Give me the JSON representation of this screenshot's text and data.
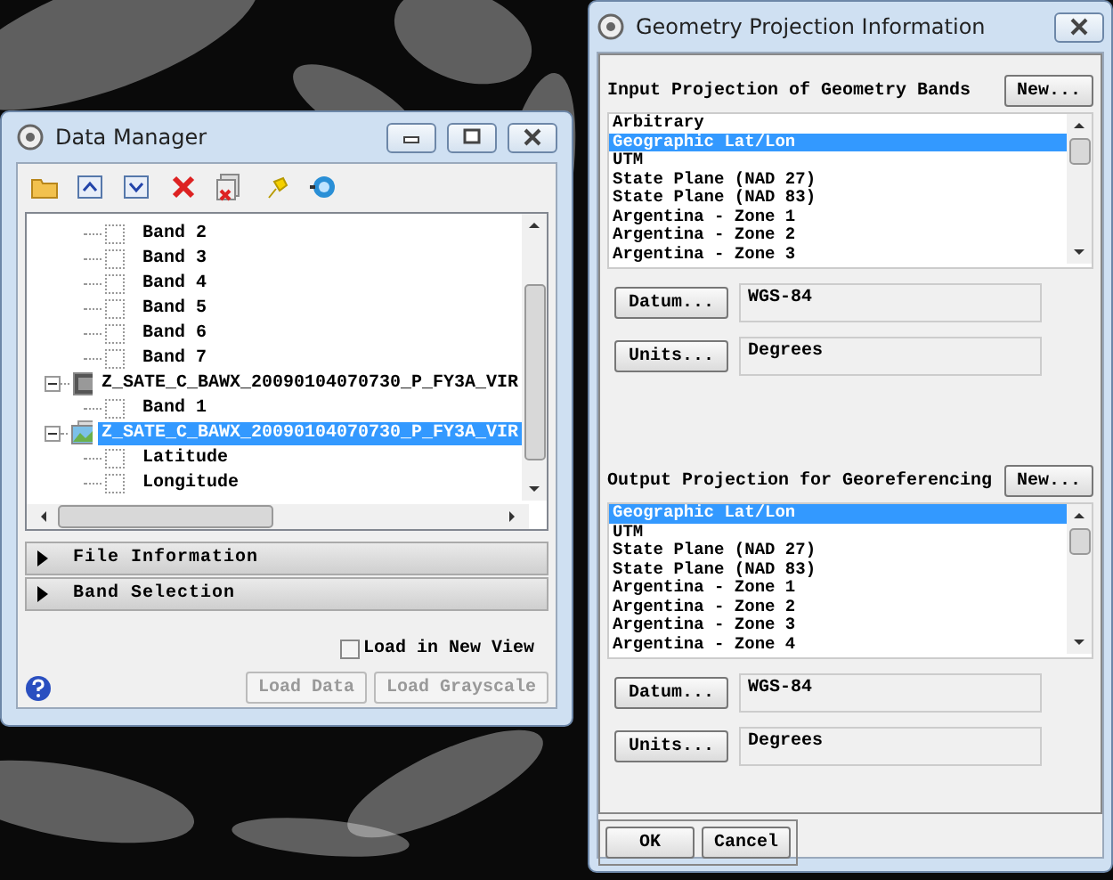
{
  "data_manager": {
    "title": "Data Manager",
    "tree": [
      {
        "children": [
          {
            "label": "Band 2",
            "checked": false
          },
          {
            "label": "Band 3",
            "checked": false
          },
          {
            "label": "Band 4",
            "checked": false
          },
          {
            "label": "Band 5",
            "checked": false
          },
          {
            "label": "Band 6",
            "checked": false
          },
          {
            "label": "Band 7",
            "checked": false
          }
        ]
      },
      {
        "label": "Z_SATE_C_BAWX_20090104070730_P_FY3A_VIR",
        "kind": "raster",
        "expanded": true,
        "selected": false,
        "children": [
          {
            "label": "Band 1",
            "checked": false
          }
        ]
      },
      {
        "label": "Z_SATE_C_BAWX_20090104070730_P_FY3A_VIR",
        "kind": "geo",
        "expanded": true,
        "selected": true,
        "children": [
          {
            "label": "Latitude",
            "checked": false
          },
          {
            "label": "Longitude",
            "checked": false
          }
        ]
      }
    ],
    "sections": [
      {
        "label": "File Information",
        "expanded": false
      },
      {
        "label": "Band Selection",
        "expanded": false
      }
    ],
    "load_in_new_view": {
      "label": "Load in New View",
      "checked": false
    },
    "buttons": [
      {
        "label": "Load Data",
        "disabled": true
      },
      {
        "label": "Load Grayscale",
        "disabled": true
      }
    ]
  },
  "projection_dialog": {
    "title": "Geometry Projection Information",
    "groups": [
      {
        "label": "Input Projection of Geometry Bands",
        "new_button": "New...",
        "items": [
          {
            "label": "Arbitrary",
            "selected": false
          },
          {
            "label": "Geographic Lat/Lon",
            "selected": true
          },
          {
            "label": "UTM",
            "selected": false
          },
          {
            "label": "State Plane (NAD 27)",
            "selected": false
          },
          {
            "label": "State Plane (NAD 83)",
            "selected": false
          },
          {
            "label": "Argentina - Zone 1",
            "selected": false
          },
          {
            "label": "Argentina - Zone 2",
            "selected": false
          },
          {
            "label": "Argentina - Zone 3",
            "selected": false
          }
        ],
        "datum_button": "Datum...",
        "datum": "WGS-84",
        "units_button": "Units...",
        "units": "Degrees"
      },
      {
        "label": "Output Projection for Georeferencing",
        "new_button": "New...",
        "items": [
          {
            "label": "Geographic Lat/Lon",
            "selected": true
          },
          {
            "label": "UTM",
            "selected": false
          },
          {
            "label": "State Plane (NAD 27)",
            "selected": false
          },
          {
            "label": "State Plane (NAD 83)",
            "selected": false
          },
          {
            "label": "Argentina - Zone 1",
            "selected": false
          },
          {
            "label": "Argentina - Zone 2",
            "selected": false
          },
          {
            "label": "Argentina - Zone 3",
            "selected": false
          },
          {
            "label": "Argentina - Zone 4",
            "selected": false
          }
        ],
        "datum_button": "Datum...",
        "datum": "WGS-84",
        "units_button": "Units...",
        "units": "Degrees"
      }
    ],
    "buttons": [
      "OK",
      "Cancel"
    ]
  }
}
